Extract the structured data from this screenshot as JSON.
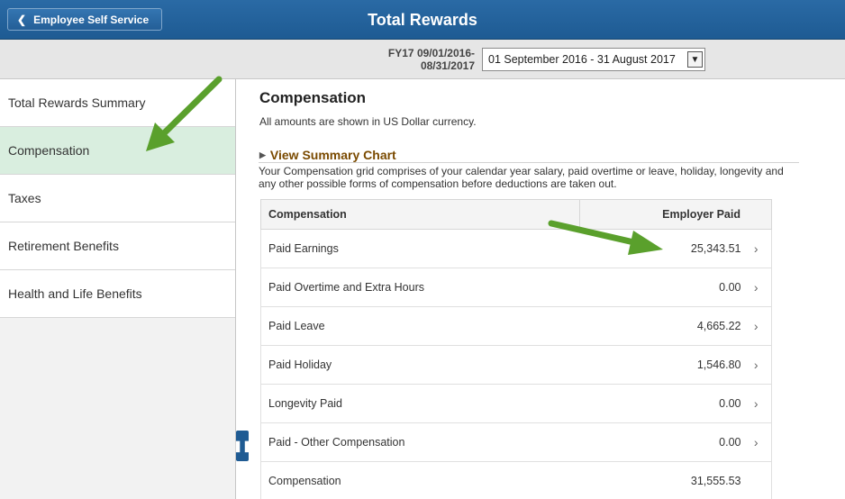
{
  "header": {
    "back_label": "Employee Self Service",
    "title": "Total Rewards"
  },
  "period": {
    "label_line1": "FY17 09/01/2016-",
    "label_line2": "08/31/2017",
    "selected": "01 September 2016 - 31 August 2017"
  },
  "sidebar": {
    "items": [
      {
        "label": "Total Rewards Summary"
      },
      {
        "label": "Compensation"
      },
      {
        "label": "Taxes"
      },
      {
        "label": "Retirement Benefits"
      },
      {
        "label": "Health and Life Benefits"
      }
    ],
    "active_index": 1
  },
  "main": {
    "title": "Compensation",
    "currency_note": "All amounts are shown in US Dollar currency.",
    "summary_link": "View Summary Chart",
    "description": "Your Compensation grid comprises of your calendar year salary, paid overtime or leave, holiday, longevity and any other possible forms of compensation before deductions are taken out.",
    "table": {
      "headers": [
        "Compensation",
        "Employer Paid"
      ],
      "rows": [
        {
          "label": "Paid Earnings",
          "amount": "25,343.51",
          "arrow": "›"
        },
        {
          "label": "Paid Overtime and Extra Hours",
          "amount": "0.00",
          "arrow": "›"
        },
        {
          "label": "Paid Leave",
          "amount": "4,665.22",
          "arrow": "›"
        },
        {
          "label": "Paid Holiday",
          "amount": "1,546.80",
          "arrow": "›"
        },
        {
          "label": "Longevity Paid",
          "amount": "0.00",
          "arrow": "›"
        },
        {
          "label": "Paid - Other Compensation",
          "amount": "0.00",
          "arrow": "›"
        },
        {
          "label": "Compensation",
          "amount": "31,555.53",
          "arrow": ""
        }
      ]
    }
  },
  "icons": {
    "back": "chevron-left-icon",
    "dropdown": "chevron-down-icon",
    "expand": "triangle-right-icon",
    "row_nav": "chevron-right-icon",
    "collapse": "pause-icon"
  },
  "colors": {
    "header_blue": "#1e5b93",
    "active_item": "#d9eedf",
    "annotation_green": "#5aa02c"
  }
}
